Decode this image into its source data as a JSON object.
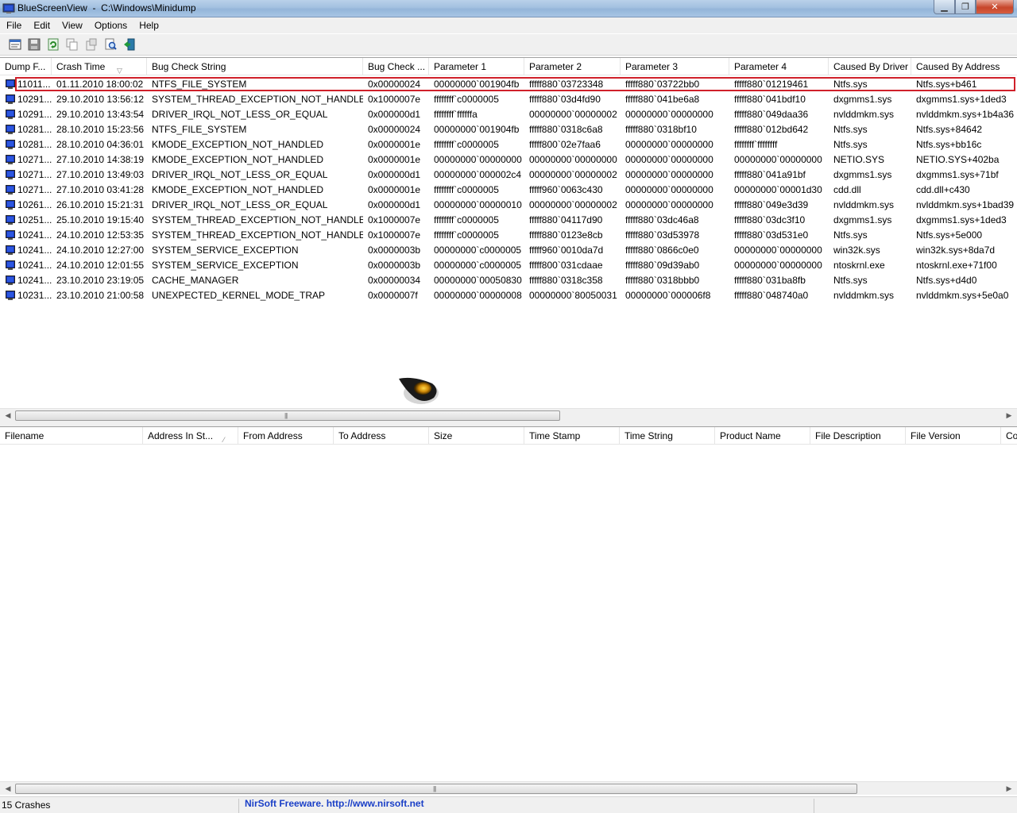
{
  "window": {
    "title": "BlueScreenView  -  C:\\Windows\\Minidump",
    "minimize_symbol": "▁",
    "maximize_symbol": "❐",
    "close_symbol": "✕"
  },
  "menu": {
    "items": [
      "File",
      "Edit",
      "View",
      "Options",
      "Help"
    ]
  },
  "toolbar": {
    "buttons": [
      {
        "name": "properties-icon"
      },
      {
        "name": "save-icon"
      },
      {
        "name": "refresh-icon"
      },
      {
        "name": "copy-icon"
      },
      {
        "name": "html-report-icon"
      },
      {
        "name": "find-icon"
      },
      {
        "name": "exit-icon"
      }
    ]
  },
  "crash_list": {
    "columns": [
      "Dump F...",
      "Crash Time",
      "Bug Check String",
      "Bug Check ...",
      "Parameter 1",
      "Parameter 2",
      "Parameter 3",
      "Parameter 4",
      "Caused By Driver",
      "Caused By Address"
    ],
    "sort_indicator": "▽",
    "rows": [
      [
        "11011...",
        "01.11.2010 18:00:02",
        "NTFS_FILE_SYSTEM",
        "0x00000024",
        "00000000`001904fb",
        "fffff880`03723348",
        "fffff880`03722bb0",
        "fffff880`01219461",
        "Ntfs.sys",
        "Ntfs.sys+b461"
      ],
      [
        "10291...",
        "29.10.2010 13:56:12",
        "SYSTEM_THREAD_EXCEPTION_NOT_HANDLED",
        "0x1000007e",
        "ffffffff`c0000005",
        "fffff880`03d4fd90",
        "fffff880`041be6a8",
        "fffff880`041bdf10",
        "dxgmms1.sys",
        "dxgmms1.sys+1ded3"
      ],
      [
        "10291...",
        "29.10.2010 13:43:54",
        "DRIVER_IRQL_NOT_LESS_OR_EQUAL",
        "0x000000d1",
        "ffffffff`ffffffa",
        "00000000`00000002",
        "00000000`00000000",
        "fffff880`049daa36",
        "nvlddmkm.sys",
        "nvlddmkm.sys+1b4a36"
      ],
      [
        "10281...",
        "28.10.2010 15:23:56",
        "NTFS_FILE_SYSTEM",
        "0x00000024",
        "00000000`001904fb",
        "fffff880`0318c6a8",
        "fffff880`0318bf10",
        "fffff880`012bd642",
        "Ntfs.sys",
        "Ntfs.sys+84642"
      ],
      [
        "10281...",
        "28.10.2010 04:36:01",
        "KMODE_EXCEPTION_NOT_HANDLED",
        "0x0000001e",
        "ffffffff`c0000005",
        "fffff800`02e7faa6",
        "00000000`00000000",
        "ffffffff`ffffffff",
        "Ntfs.sys",
        "Ntfs.sys+bb16c"
      ],
      [
        "10271...",
        "27.10.2010 14:38:19",
        "KMODE_EXCEPTION_NOT_HANDLED",
        "0x0000001e",
        "00000000`00000000",
        "00000000`00000000",
        "00000000`00000000",
        "00000000`00000000",
        "NETIO.SYS",
        "NETIO.SYS+402ba"
      ],
      [
        "10271...",
        "27.10.2010 13:49:03",
        "DRIVER_IRQL_NOT_LESS_OR_EQUAL",
        "0x000000d1",
        "00000000`000002c4",
        "00000000`00000002",
        "00000000`00000000",
        "fffff880`041a91bf",
        "dxgmms1.sys",
        "dxgmms1.sys+71bf"
      ],
      [
        "10271...",
        "27.10.2010 03:41:28",
        "KMODE_EXCEPTION_NOT_HANDLED",
        "0x0000001e",
        "ffffffff`c0000005",
        "fffff960`0063c430",
        "00000000`00000000",
        "00000000`00001d30",
        "cdd.dll",
        "cdd.dll+c430"
      ],
      [
        "10261...",
        "26.10.2010 15:21:31",
        "DRIVER_IRQL_NOT_LESS_OR_EQUAL",
        "0x000000d1",
        "00000000`00000010",
        "00000000`00000002",
        "00000000`00000000",
        "fffff880`049e3d39",
        "nvlddmkm.sys",
        "nvlddmkm.sys+1bad39"
      ],
      [
        "10251...",
        "25.10.2010 19:15:40",
        "SYSTEM_THREAD_EXCEPTION_NOT_HANDLED",
        "0x1000007e",
        "ffffffff`c0000005",
        "fffff880`04117d90",
        "fffff880`03dc46a8",
        "fffff880`03dc3f10",
        "dxgmms1.sys",
        "dxgmms1.sys+1ded3"
      ],
      [
        "10241...",
        "24.10.2010 12:53:35",
        "SYSTEM_THREAD_EXCEPTION_NOT_HANDLED",
        "0x1000007e",
        "ffffffff`c0000005",
        "fffff880`0123e8cb",
        "fffff880`03d53978",
        "fffff880`03d531e0",
        "Ntfs.sys",
        "Ntfs.sys+5e000"
      ],
      [
        "10241...",
        "24.10.2010 12:27:00",
        "SYSTEM_SERVICE_EXCEPTION",
        "0x0000003b",
        "00000000`c0000005",
        "fffff960`0010da7d",
        "fffff880`0866c0e0",
        "00000000`00000000",
        "win32k.sys",
        "win32k.sys+8da7d"
      ],
      [
        "10241...",
        "24.10.2010 12:01:55",
        "SYSTEM_SERVICE_EXCEPTION",
        "0x0000003b",
        "00000000`c0000005",
        "fffff800`031cdaae",
        "fffff880`09d39ab0",
        "00000000`00000000",
        "ntoskrnl.exe",
        "ntoskrnl.exe+71f00"
      ],
      [
        "10241...",
        "23.10.2010 23:19:05",
        "CACHE_MANAGER",
        "0x00000034",
        "00000000`00050830",
        "fffff880`0318c358",
        "fffff880`0318bbb0",
        "fffff880`031ba8fb",
        "Ntfs.sys",
        "Ntfs.sys+d4d0"
      ],
      [
        "10231...",
        "23.10.2010 21:00:58",
        "UNEXPECTED_KERNEL_MODE_TRAP",
        "0x0000007f",
        "00000000`00000008",
        "00000000`80050031",
        "00000000`000006f8",
        "fffff880`048740a0",
        "nvlddmkm.sys",
        "nvlddmkm.sys+5e0a0"
      ]
    ],
    "selected_row": 0
  },
  "driver_list": {
    "columns": [
      "Filename",
      "Address In St...",
      "From Address",
      "To Address",
      "Size",
      "Time Stamp",
      "Time String",
      "Product Name",
      "File Description",
      "File Version",
      "Co"
    ],
    "sort_indicator": "⁄",
    "rows": []
  },
  "scrollbar": {
    "left_arrow": "◀",
    "right_arrow": "▶",
    "grip": "|||"
  },
  "status": {
    "crash_count": "15 Crashes",
    "credit": "NirSoft Freeware.  http://www.nirsoft.net"
  },
  "colors": {
    "selection_border": "#d0202a",
    "credit_link": "#1a3fc7",
    "titlebar": "#a3c0e0"
  }
}
